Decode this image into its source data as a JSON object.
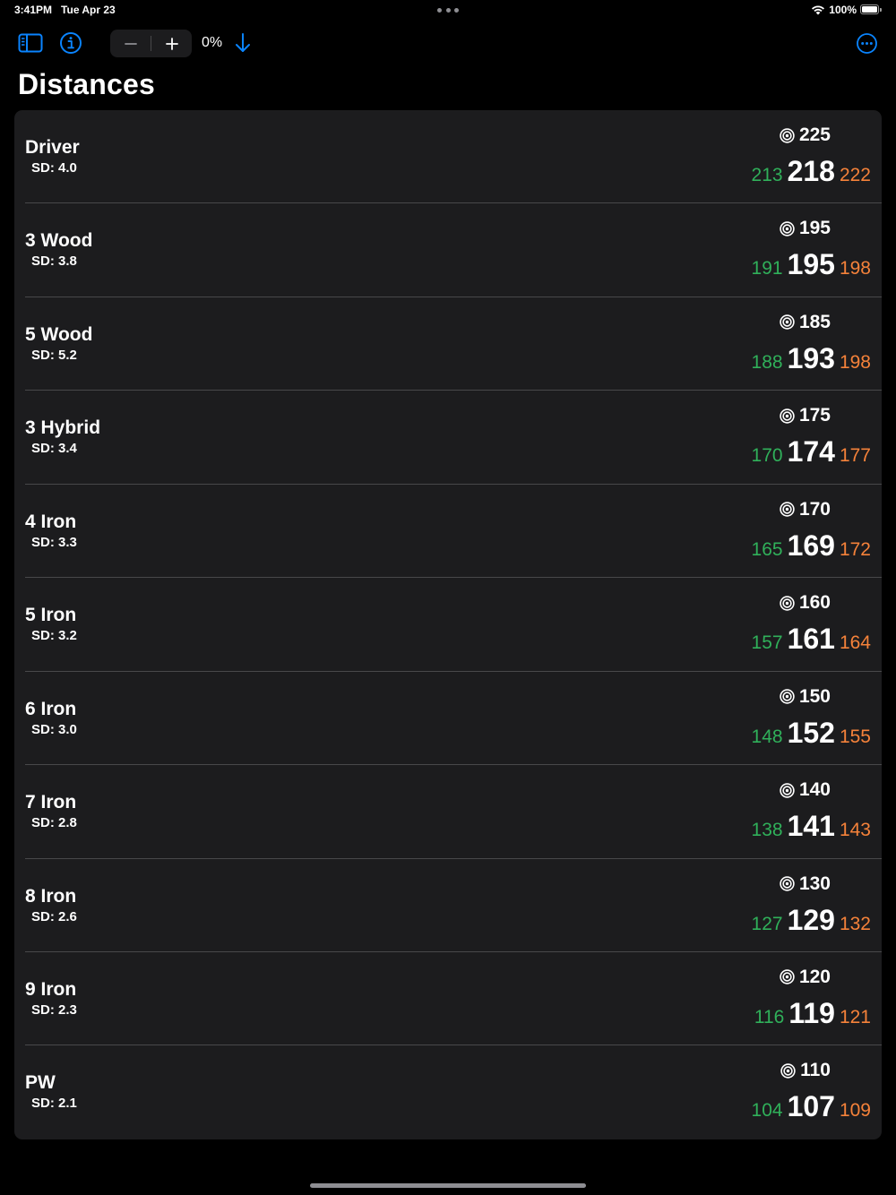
{
  "status_bar": {
    "time": "3:41PM",
    "date": "Tue Apr 23",
    "battery": "100%",
    "wifi_icon": "wifi-icon",
    "battery_icon": "battery-icon"
  },
  "toolbar": {
    "sidebar_icon": "sidebar-icon",
    "info_icon": "info-icon",
    "minus_label": "−",
    "plus_label": "+",
    "zoom_value": "0%",
    "sort_icon": "arrow-down-icon",
    "more_icon": "ellipsis-circle-icon",
    "accent_color": "#0a84ff"
  },
  "page": {
    "title": "Distances"
  },
  "colors": {
    "min": "#30b05a",
    "max": "#f5823a",
    "card": "#1c1c1e"
  },
  "clubs": [
    {
      "name": "Driver",
      "sd": "SD: 4.0",
      "target": "225",
      "min": "213",
      "avg": "218",
      "max": "222"
    },
    {
      "name": "3 Wood",
      "sd": "SD: 3.8",
      "target": "195",
      "min": "191",
      "avg": "195",
      "max": "198"
    },
    {
      "name": "5 Wood",
      "sd": "SD: 5.2",
      "target": "185",
      "min": "188",
      "avg": "193",
      "max": "198"
    },
    {
      "name": "3 Hybrid",
      "sd": "SD: 3.4",
      "target": "175",
      "min": "170",
      "avg": "174",
      "max": "177"
    },
    {
      "name": "4 Iron",
      "sd": "SD: 3.3",
      "target": "170",
      "min": "165",
      "avg": "169",
      "max": "172"
    },
    {
      "name": "5 Iron",
      "sd": "SD: 3.2",
      "target": "160",
      "min": "157",
      "avg": "161",
      "max": "164"
    },
    {
      "name": "6 Iron",
      "sd": "SD: 3.0",
      "target": "150",
      "min": "148",
      "avg": "152",
      "max": "155"
    },
    {
      "name": "7 Iron",
      "sd": "SD: 2.8",
      "target": "140",
      "min": "138",
      "avg": "141",
      "max": "143"
    },
    {
      "name": "8 Iron",
      "sd": "SD: 2.6",
      "target": "130",
      "min": "127",
      "avg": "129",
      "max": "132"
    },
    {
      "name": "9 Iron",
      "sd": "SD: 2.3",
      "target": "120",
      "min": "116",
      "avg": "119",
      "max": "121"
    },
    {
      "name": "PW",
      "sd": "SD: 2.1",
      "target": "110",
      "min": "104",
      "avg": "107",
      "max": "109"
    }
  ]
}
